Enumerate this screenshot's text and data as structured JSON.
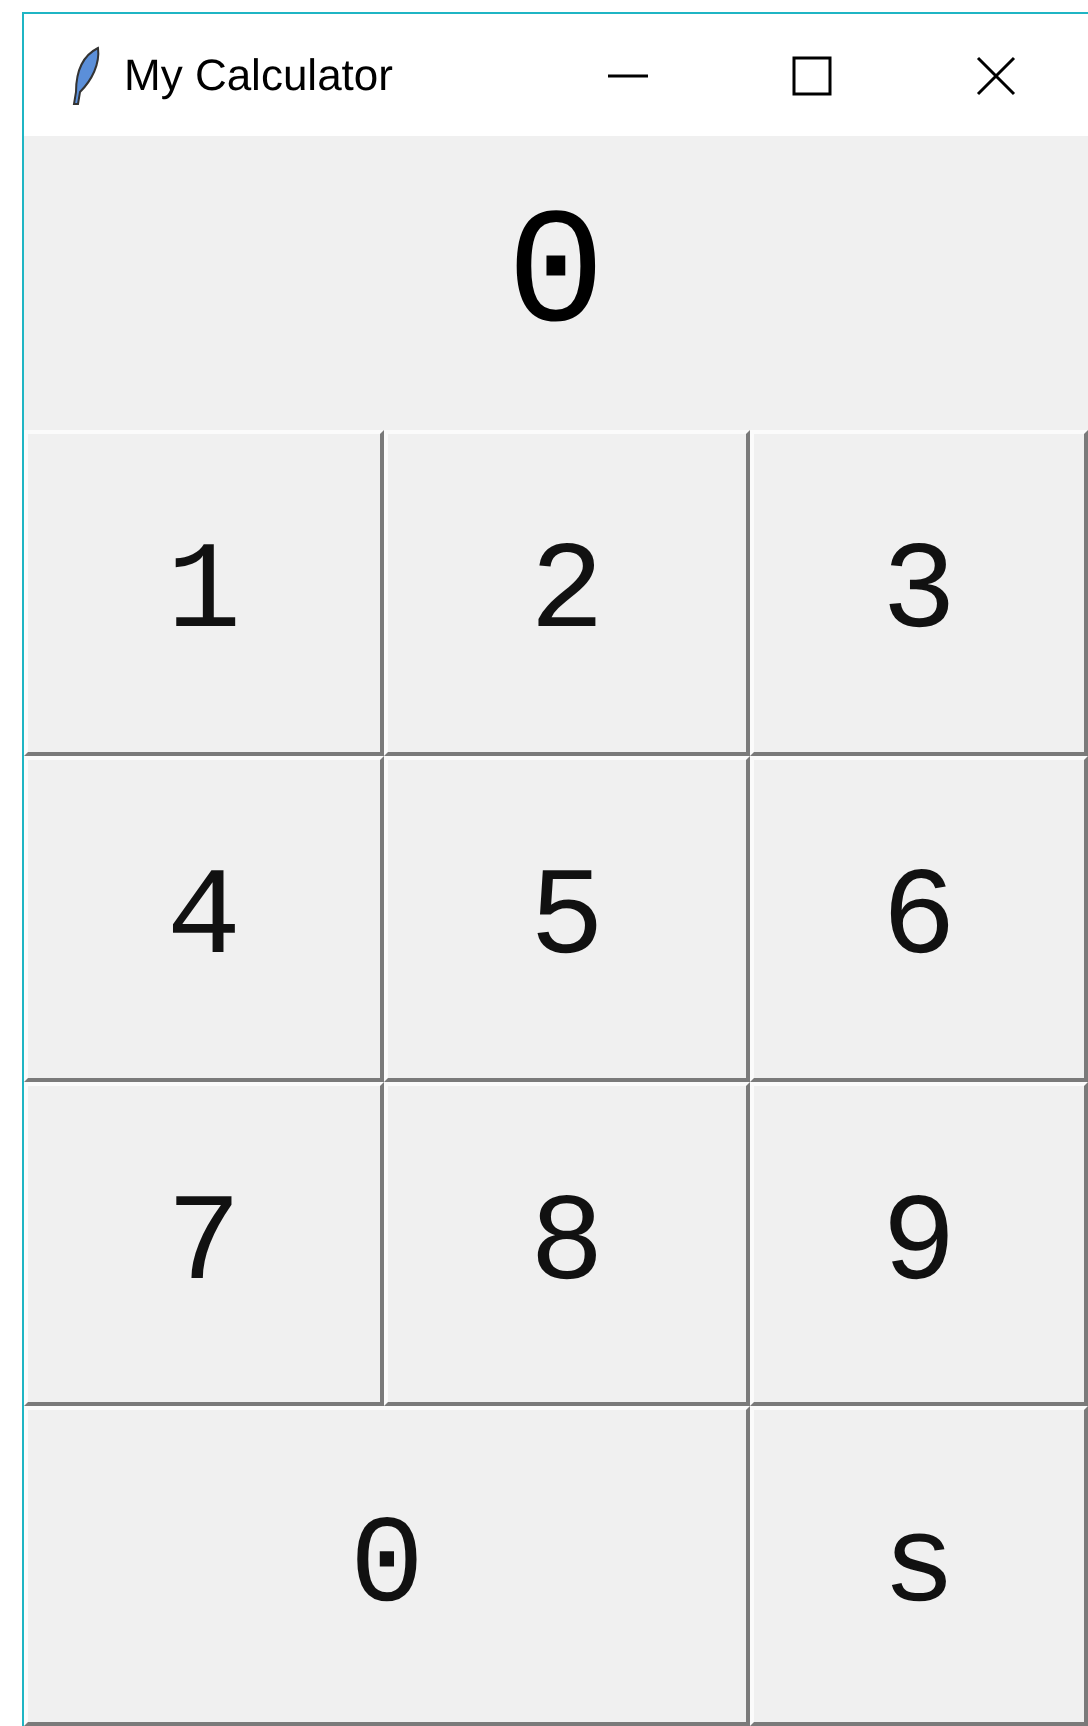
{
  "window": {
    "title": "My Calculator"
  },
  "display": {
    "value": "0"
  },
  "keys": [
    {
      "label": "1",
      "wide": false
    },
    {
      "label": "2",
      "wide": false
    },
    {
      "label": "3",
      "wide": false
    },
    {
      "label": "4",
      "wide": false
    },
    {
      "label": "5",
      "wide": false
    },
    {
      "label": "6",
      "wide": false
    },
    {
      "label": "7",
      "wide": false
    },
    {
      "label": "8",
      "wide": false
    },
    {
      "label": "9",
      "wide": false
    },
    {
      "label": "0",
      "wide": true
    },
    {
      "label": "s",
      "wide": false
    }
  ]
}
